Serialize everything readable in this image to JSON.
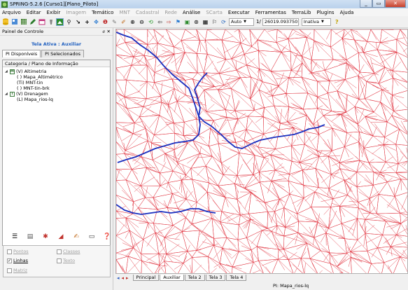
{
  "window": {
    "title": "SPRING-5.2.6 [Curso1][Plano_Piloto]"
  },
  "menu": [
    {
      "label": "Arquivo",
      "enabled": true
    },
    {
      "label": "Editar",
      "enabled": true
    },
    {
      "label": "Exibir",
      "enabled": true
    },
    {
      "label": "Imagem",
      "enabled": false
    },
    {
      "label": "Temático",
      "enabled": true
    },
    {
      "label": "MNT",
      "enabled": false
    },
    {
      "label": "Cadastral",
      "enabled": false
    },
    {
      "label": "Rede",
      "enabled": false
    },
    {
      "label": "Análise",
      "enabled": true
    },
    {
      "label": "SCarta",
      "enabled": false
    },
    {
      "label": "Executar",
      "enabled": true
    },
    {
      "label": "Ferramentas",
      "enabled": true
    },
    {
      "label": "TerraLib",
      "enabled": true
    },
    {
      "label": "Plugins",
      "enabled": true
    },
    {
      "label": "Ajuda",
      "enabled": true
    }
  ],
  "toolbar": {
    "mode_value": "Auto",
    "scale_prefix": "1/",
    "scale_value": "26019.093750",
    "state_value": "Inativa"
  },
  "panel": {
    "title": "Painel de Controle",
    "close_glyph": "ⅇ ✕",
    "active_screen": "Tela Ativa : Auxiliar",
    "tabs": [
      "PI Disponíveis",
      "PI Selecionados"
    ],
    "tree_header": "Categoria / Plano de Informação",
    "tree": [
      {
        "indent": 0,
        "expander": "◢",
        "badge": "M",
        "label": "(V) Altimetria"
      },
      {
        "indent": 1,
        "expander": "",
        "badge": "",
        "label": "( ) Mapa_Altimétrico"
      },
      {
        "indent": 1,
        "expander": "",
        "badge": "",
        "label": "(Ti) MNT-tin"
      },
      {
        "indent": 1,
        "expander": "",
        "badge": "",
        "label": "( ) MNT-tin-brk"
      },
      {
        "indent": 0,
        "expander": "◢",
        "badge": "T",
        "label": "(V) Drenagem"
      },
      {
        "indent": 1,
        "expander": "",
        "badge": "",
        "label": "(L) Mapa_rios-lq"
      }
    ],
    "checkboxes": [
      {
        "label": "Pontos",
        "checked": false,
        "enabled": false
      },
      {
        "label": "Classes",
        "checked": false,
        "enabled": false
      },
      {
        "label": "Linhas",
        "checked": true,
        "enabled": true
      },
      {
        "label": "Texto",
        "checked": false,
        "enabled": false
      },
      {
        "label": "Matriz",
        "checked": false,
        "enabled": false
      }
    ]
  },
  "bottom_tabs": [
    "Principal",
    "Auxiliar",
    "Tela 2",
    "Tela 3",
    "Tela 4"
  ],
  "active_bottom_tab": "Auxiliar",
  "status": {
    "text": "PI: Mapa_rios-lq"
  },
  "colors": {
    "tin_edges": "#e0303c",
    "rivers": "#1a2fbf",
    "accent": "#1f5fbf"
  }
}
